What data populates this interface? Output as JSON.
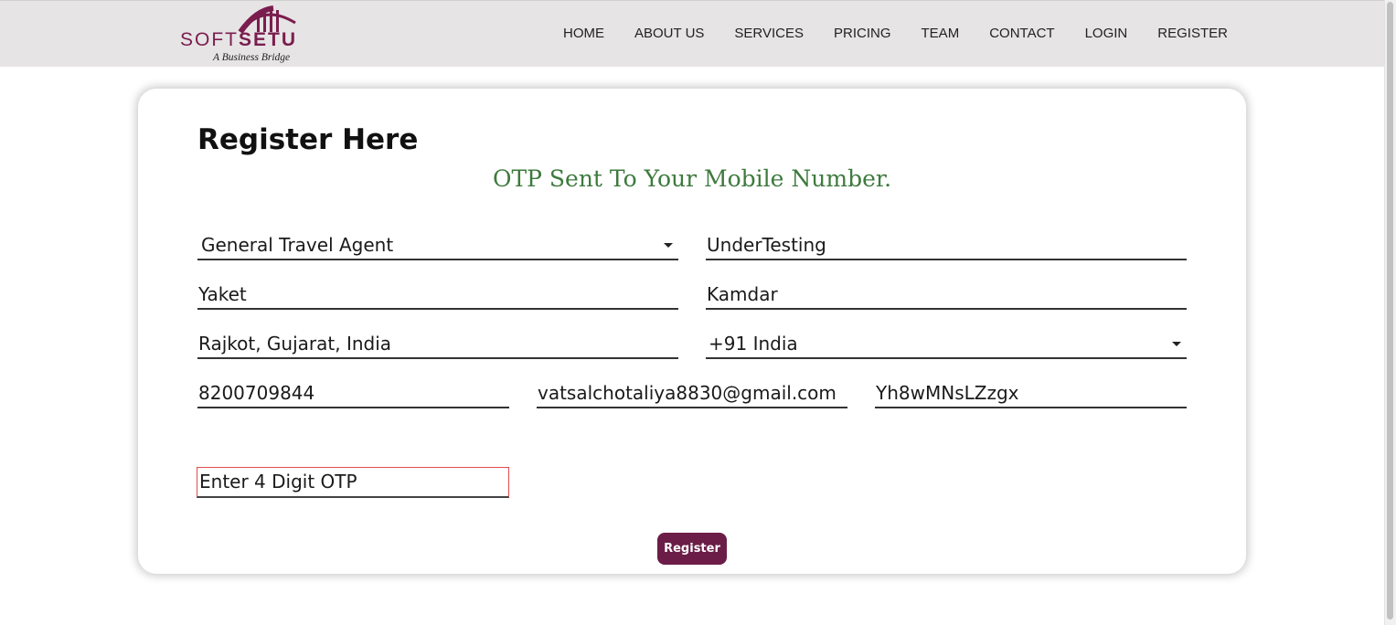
{
  "brand": {
    "name_part1": "SOFT",
    "name_part2": "SETU",
    "tagline": "A Business Bridge",
    "color": "#7a1d4e"
  },
  "nav": {
    "items": [
      {
        "label": "HOME"
      },
      {
        "label": "ABOUT US"
      },
      {
        "label": "SERVICES"
      },
      {
        "label": "PRICING"
      },
      {
        "label": "TEAM"
      },
      {
        "label": "CONTACT"
      },
      {
        "label": "LOGIN"
      },
      {
        "label": "REGISTER"
      }
    ]
  },
  "form": {
    "title": "Register Here",
    "status_message": "OTP Sent To Your Mobile Number.",
    "status_color": "#3d7a3d",
    "agent_type": "General Travel Agent",
    "company_name": "UnderTesting",
    "first_name": "Yaket",
    "last_name": "Kamdar",
    "location": "Rajkot, Gujarat, India",
    "country_code": "+91 India",
    "mobile": "8200709844",
    "email": "vatsalchotaliya8830@gmail.com",
    "password": "Yh8wMNsLZzgx",
    "otp_placeholder": "Enter 4 Digit OTP",
    "submit_label": "Register",
    "submit_color": "#6b1d47"
  }
}
